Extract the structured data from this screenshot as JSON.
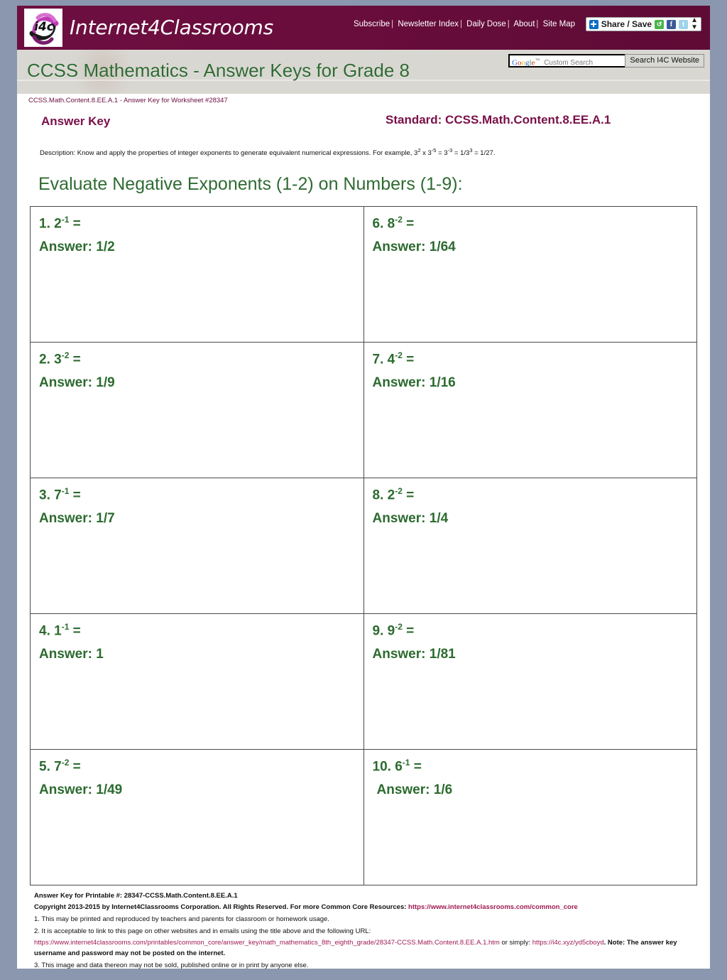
{
  "site": {
    "brand": "Internet4Classrooms",
    "logo_text": "i4c",
    "nav": [
      {
        "label": "Subscribe"
      },
      {
        "label": "Newsletter Index"
      },
      {
        "label": "Daily Dose"
      },
      {
        "label": "About"
      },
      {
        "label": "Site Map"
      }
    ],
    "share": {
      "label": "Share / Save",
      "plus_icon": "plus-square-icon",
      "share_icon": "addthis-icon",
      "facebook_icon": "facebook-icon",
      "twitter_icon": "twitter-icon",
      "arrows_icon": "updown-arrows-icon"
    },
    "search": {
      "google_mark": "Google",
      "google_tm": "™",
      "placeholder": "Custom Search",
      "value": "",
      "button_label": "Search I4C Website"
    }
  },
  "banner": {
    "title": "CCSS Mathematics - Answer Keys for Grade 8"
  },
  "breadcrumb": "CCSS.Math.Content.8.EE.A.1 - Answer Key for Worksheet #28347",
  "header": {
    "answer_key_label": "Answer Key",
    "standard_label": "Standard: CCSS.Math.Content.8.EE.A.1"
  },
  "description": {
    "prefix": "Description: Know and apply the properties of integer exponents to generate equivalent numerical expressions. For example, 3",
    "sup1": "2",
    "mid1": " x 3",
    "sup2": "-5",
    "mid2": " = 3",
    "sup3": "-3",
    "mid3": " = 1/3",
    "sup4": "3",
    "suffix": " = 1/27."
  },
  "worksheet_title": "Evaluate Negative Exponents (1-2) on Numbers (1-9):",
  "problems": [
    {
      "number": "1.",
      "base": "2",
      "exponent": "-1",
      "equals": "=",
      "answer_label": "Answer:",
      "answer": "1/2"
    },
    {
      "number": "6.",
      "base": "8",
      "exponent": "-2",
      "equals": "=",
      "answer_label": "Answer:",
      "answer": "1/64"
    },
    {
      "number": "2.",
      "base": "3",
      "exponent": "-2",
      "equals": "=",
      "answer_label": "Answer:",
      "answer": "1/9"
    },
    {
      "number": "7.",
      "base": "4",
      "exponent": "-2",
      "equals": "=",
      "answer_label": "Answer:",
      "answer": "1/16"
    },
    {
      "number": "3.",
      "base": "7",
      "exponent": "-1",
      "equals": "=",
      "answer_label": "Answer:",
      "answer": "1/7"
    },
    {
      "number": "8.",
      "base": "2",
      "exponent": "-2",
      "equals": "=",
      "answer_label": "Answer:",
      "answer": "1/4"
    },
    {
      "number": "4.",
      "base": "1",
      "exponent": "-1",
      "equals": "=",
      "answer_label": "Answer:",
      "answer": "1"
    },
    {
      "number": "9.",
      "base": "9",
      "exponent": "-2",
      "equals": "=",
      "answer_label": "Answer:",
      "answer": "1/81"
    },
    {
      "number": "5.",
      "base": "7",
      "exponent": "-2",
      "equals": "=",
      "answer_label": "Answer:",
      "answer": "1/49"
    },
    {
      "number": "10.",
      "base": "6",
      "exponent": "-1",
      "equals": "=",
      "answer_label": "Answer:",
      "answer": "1/6"
    }
  ],
  "footer": {
    "printable_line": "Answer Key for Printable #: 28347-CCSS.Math.Content.8.EE.A.1",
    "copyright_text": "Copyright 2013-2015 by Internet4Classrooms Corporation. All Rights Reserved. For more Common Core Resources: ",
    "copyright_link": "https://www.internet4classrooms.com/common_core",
    "note_1": "1. This may be printed and reproduced by teachers and parents for classroom or homework usage.",
    "note_2": "2. It is acceptable to link to this page on other websites and in emails using the title above and the following URL:",
    "note_2_url": "https://www.internet4classrooms.com/printables/common_core/answer_key/math_mathematics_8th_eighth_grade/28347-CCSS.Math.Content.8.EE.A.1.htm",
    "note_2_mid": " or simply: ",
    "note_2_short_url": "https://i4c.xyz/yd5cboyd",
    "note_2_tail": ". Note: The answer key username and password may not be posted on the internet.",
    "note_3": "3. This image and data thereon may not be sold, published online or in print by anyone else."
  },
  "colors": {
    "brand_maroon": "#6a0d3d",
    "heading_green": "#2f6b33",
    "answer_green": "#2c6b2f",
    "label_purple": "#7a1049",
    "page_background": "#8a97ae",
    "link_magenta": "#9e1b52"
  }
}
